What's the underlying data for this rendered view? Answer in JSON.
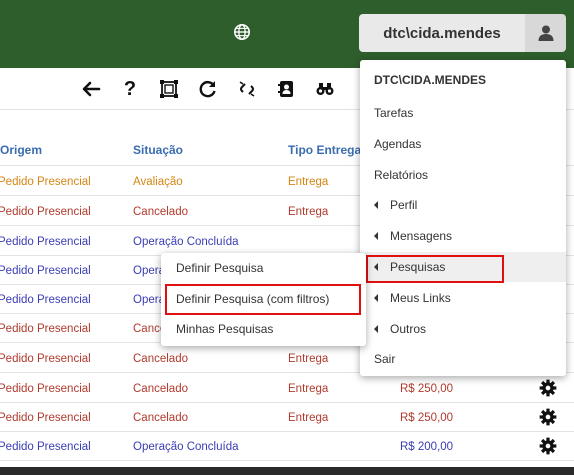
{
  "header": {
    "user_label": "dtc\\cida.mendes",
    "icons": [
      "globe-icon",
      "user-icon"
    ]
  },
  "toolbar": {
    "icons": [
      "back-arrow-icon",
      "help-icon",
      "select-frame-icon",
      "refresh-icon",
      "unlink-icon",
      "contacts-icon",
      "binoculars-icon"
    ]
  },
  "table": {
    "headers": [
      "Origem",
      "Situação",
      "Tipo Entrega"
    ],
    "rows": [
      {
        "origem": "Pedido Presencial",
        "situacao": "Avaliação",
        "tipo": "Entrega",
        "valor": "",
        "color": "orange",
        "gear": false
      },
      {
        "origem": "Pedido Presencial",
        "situacao": "Cancelado",
        "tipo": "Entrega",
        "valor": "",
        "color": "red",
        "gear": false
      },
      {
        "origem": "Pedido Presencial",
        "situacao": "Operação Concluída",
        "tipo": "",
        "valor": "",
        "color": "blue",
        "gear": false
      },
      {
        "origem": "Pedido Presencial",
        "situacao": "Opera",
        "tipo": "",
        "valor": "",
        "color": "blue",
        "gear": false
      },
      {
        "origem": "Pedido Presencial",
        "situacao": "Opera",
        "tipo": "",
        "valor": "",
        "color": "blue",
        "gear": false
      },
      {
        "origem": "Pedido Presencial",
        "situacao": "Cance",
        "tipo": "",
        "valor": "",
        "color": "red",
        "gear": false
      },
      {
        "origem": "Pedido Presencial",
        "situacao": "Cancelado",
        "tipo": "Entrega",
        "valor": "",
        "color": "red",
        "gear": false
      },
      {
        "origem": "Pedido Presencial",
        "situacao": "Cancelado",
        "tipo": "Entrega",
        "valor": "R$ 250,00",
        "color": "red",
        "gear": true
      },
      {
        "origem": "Pedido Presencial",
        "situacao": "Cancelado",
        "tipo": "Entrega",
        "valor": "R$ 250,00",
        "color": "red",
        "gear": true
      },
      {
        "origem": "Pedido Presencial",
        "situacao": "Operação Concluída",
        "tipo": "",
        "valor": "R$ 200,00",
        "color": "blue",
        "gear": true
      }
    ]
  },
  "user_menu": {
    "title": "DTC\\CIDA.MENDES",
    "items": [
      {
        "label": "Tarefas",
        "submenu": false
      },
      {
        "label": "Agendas",
        "submenu": false
      },
      {
        "label": "Relatórios",
        "submenu": false
      },
      {
        "label": "Perfil",
        "submenu": true
      },
      {
        "label": "Mensagens",
        "submenu": true
      },
      {
        "label": "Pesquisas",
        "submenu": true
      },
      {
        "label": "Meus Links",
        "submenu": true
      },
      {
        "label": "Outros",
        "submenu": true
      },
      {
        "label": "Sair",
        "submenu": false
      }
    ]
  },
  "submenu": {
    "items": [
      "Definir Pesquisa",
      "Definir Pesquisa (com filtros)",
      "Minhas Pesquisas"
    ]
  },
  "colors": {
    "topbar": "#2e5e2b",
    "header_text": "#3a6db0",
    "red": "#b03a2e",
    "orange": "#d58512",
    "blue": "#3a3db3",
    "highlight": "#e01010"
  }
}
